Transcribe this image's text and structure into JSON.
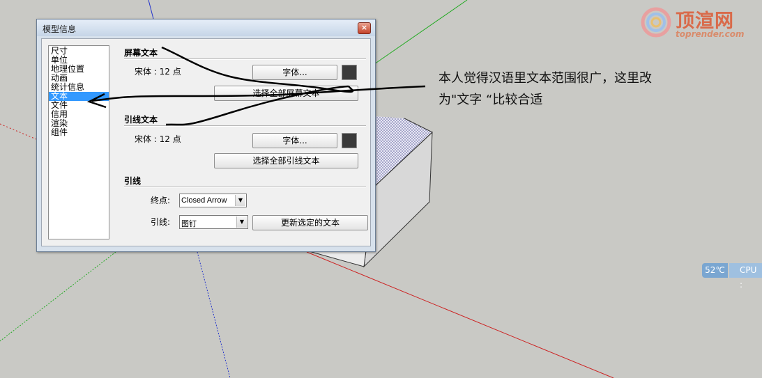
{
  "dialog": {
    "title": "模型信息",
    "close_glyph": "×",
    "nav_items": [
      "尺寸",
      "单位",
      "地理位置",
      "动画",
      "统计信息",
      "文本",
      "文件",
      "信用",
      "渲染",
      "组件"
    ],
    "selected_index": 5,
    "screen_text": {
      "title": "屏幕文本",
      "font_info": "宋体 : 12 点",
      "font_button": "字体...",
      "select_all_button": "选择全部屏幕文本",
      "swatch_color": "#3a3a3a"
    },
    "leader_text": {
      "title": "引线文本",
      "font_info": "宋体 : 12 点",
      "font_button": "字体...",
      "select_all_button": "选择全部引线文本",
      "swatch_color": "#3a3a3a"
    },
    "leader": {
      "title": "引线",
      "endpoint_label": "终点:",
      "endpoint_value": "Closed Arrow",
      "leader_label": "引线:",
      "leader_value": "图钉",
      "update_button": "更新选定的文本"
    }
  },
  "annotation": {
    "line1": "本人觉得汉语里文本范围很广，这里改",
    "line2": "为\"文字 “比较合适"
  },
  "logo": {
    "text": "顶渲网",
    "sub": "toprender.com"
  },
  "status": {
    "temperature": "52℃",
    "cpu_label": "CPU :"
  },
  "colors": {
    "background": "#c9c9c5",
    "axis_red": "#cc2222",
    "axis_green": "#22aa22",
    "axis_blue": "#2233cc",
    "selection": "#3399ff"
  }
}
